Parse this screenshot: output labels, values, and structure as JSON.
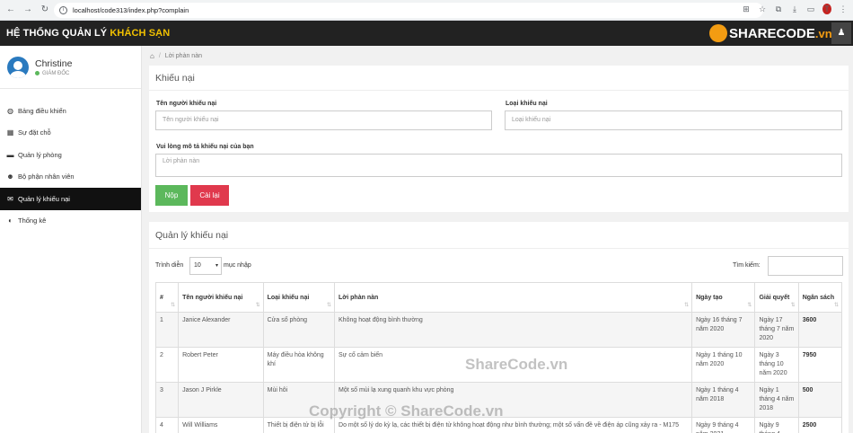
{
  "browser": {
    "url": "localhost/code313/index.php?complain",
    "profile_initial": "T"
  },
  "header": {
    "title_main": "HỆ THỐNG QUẢN LÝ ",
    "title_accent": "KHÁCH SẠN",
    "logo_text": "SHARECODE",
    "logo_suffix": ".vn"
  },
  "sidebar": {
    "user_name": "Christine",
    "user_role": "GIÁM ĐỐC",
    "items": [
      {
        "label": "Bảng điều khiển",
        "icon": "dashboard-icon",
        "glyph": "◍"
      },
      {
        "label": "Sự đặt chỗ",
        "icon": "calendar-icon",
        "glyph": "▦"
      },
      {
        "label": "Quản lý phòng",
        "icon": "bed-icon",
        "glyph": "▬"
      },
      {
        "label": "Bộ phận nhân viên",
        "icon": "users-icon",
        "glyph": "☻"
      },
      {
        "label": "Quản lý khiếu nại",
        "icon": "comments-icon",
        "glyph": "✉"
      },
      {
        "label": "Thống kê",
        "icon": "pie-chart-icon",
        "glyph": "◐"
      }
    ],
    "active_index": 4
  },
  "breadcrumb": {
    "current": "Lời phàn nàn"
  },
  "complaint_form": {
    "title": "Khiếu nại",
    "name_label": "Tên người khiếu nại",
    "name_placeholder": "Tên người khiếu nại",
    "type_label": "Loại khiếu nại",
    "type_placeholder": "Loại khiếu nại",
    "desc_label": "Vui lòng mô tả khiếu nại của bạn",
    "desc_placeholder": "Lời phàn nàn",
    "submit_label": "Nộp",
    "reset_label": "Cài lại"
  },
  "complaint_table": {
    "title": "Quản lý khiếu nại",
    "show_label": "Trình diễn",
    "page_size": "10",
    "entries_label": "mục nhập",
    "search_label": "Tìm kiếm:",
    "columns": [
      "#",
      "Tên người khiếu nại",
      "Loại khiếu nại",
      "Lời phàn nàn",
      "Ngày tạo",
      "Giải quyết",
      "Ngân sách"
    ],
    "rows": [
      [
        "1",
        "Janice Alexander",
        "Cửa sổ phòng",
        "Không hoạt động bình thường",
        "Ngày 16 tháng 7 năm 2020",
        "Ngày 17 tháng 7 năm 2020",
        "3600"
      ],
      [
        "2",
        "Robert Peter",
        "Máy điều hòa không khí",
        "Sự cố cảm biến",
        "Ngày 1 tháng 10 năm 2020",
        "Ngày 3 tháng 10 năm 2020",
        "7950"
      ],
      [
        "3",
        "Jason J Pirkle",
        "Mùi hôi",
        "Một số mùi lạ xung quanh khu vực phòng",
        "Ngày 1 tháng 4 năm 2018",
        "Ngày 1 tháng 4 năm 2018",
        "500"
      ],
      [
        "4",
        "Will Williams",
        "Thiết bị điện tử bị lỗi",
        "Do một số lý do kỳ lạ, các thiết bị điện tử không hoạt động như bình thường; một số vấn đề về điện áp cũng xảy ra - M175",
        "Ngày 9 tháng 4 năm 2021",
        "Ngày 9 tháng 4",
        "2500"
      ]
    ]
  },
  "watermarks": {
    "center": "ShareCode.vn",
    "bottom": "Copyright © ShareCode.vn"
  }
}
